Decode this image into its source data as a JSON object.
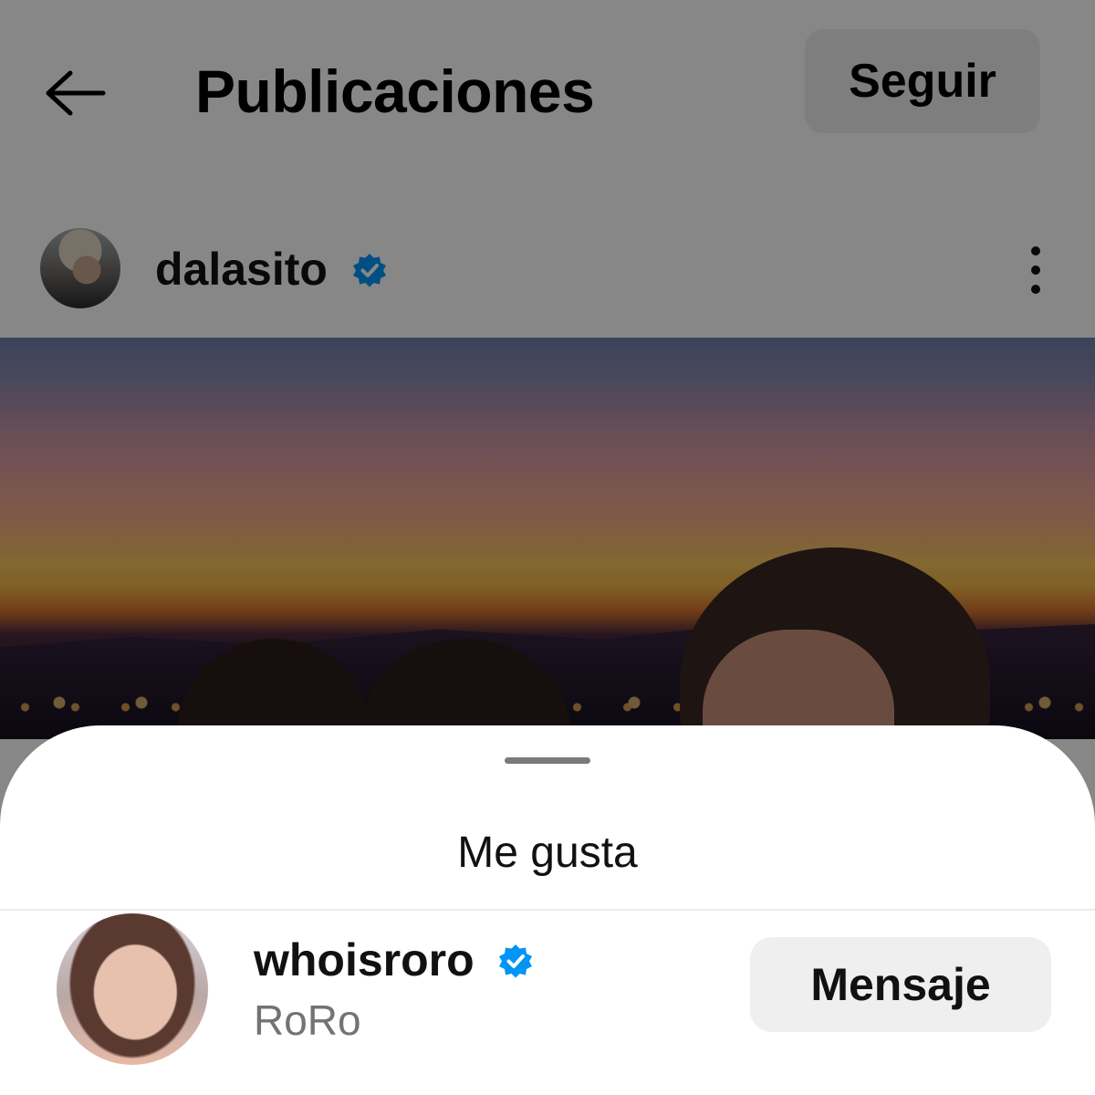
{
  "header": {
    "back_icon": "arrow-left-icon",
    "title": "Publicaciones",
    "follow_label": "Seguir"
  },
  "post": {
    "username": "dalasito",
    "verified_icon": "verified-badge-icon",
    "more_icon": "more-vertical-icon"
  },
  "likes_sheet": {
    "title": "Me gusta",
    "likers": [
      {
        "username": "whoisroro",
        "full_name": "RoRo",
        "verified": true,
        "action_label": "Mensaje"
      }
    ]
  },
  "colors": {
    "verified_blue": "#0095f6",
    "button_gray": "#efefef",
    "secondary_text": "#737373"
  }
}
